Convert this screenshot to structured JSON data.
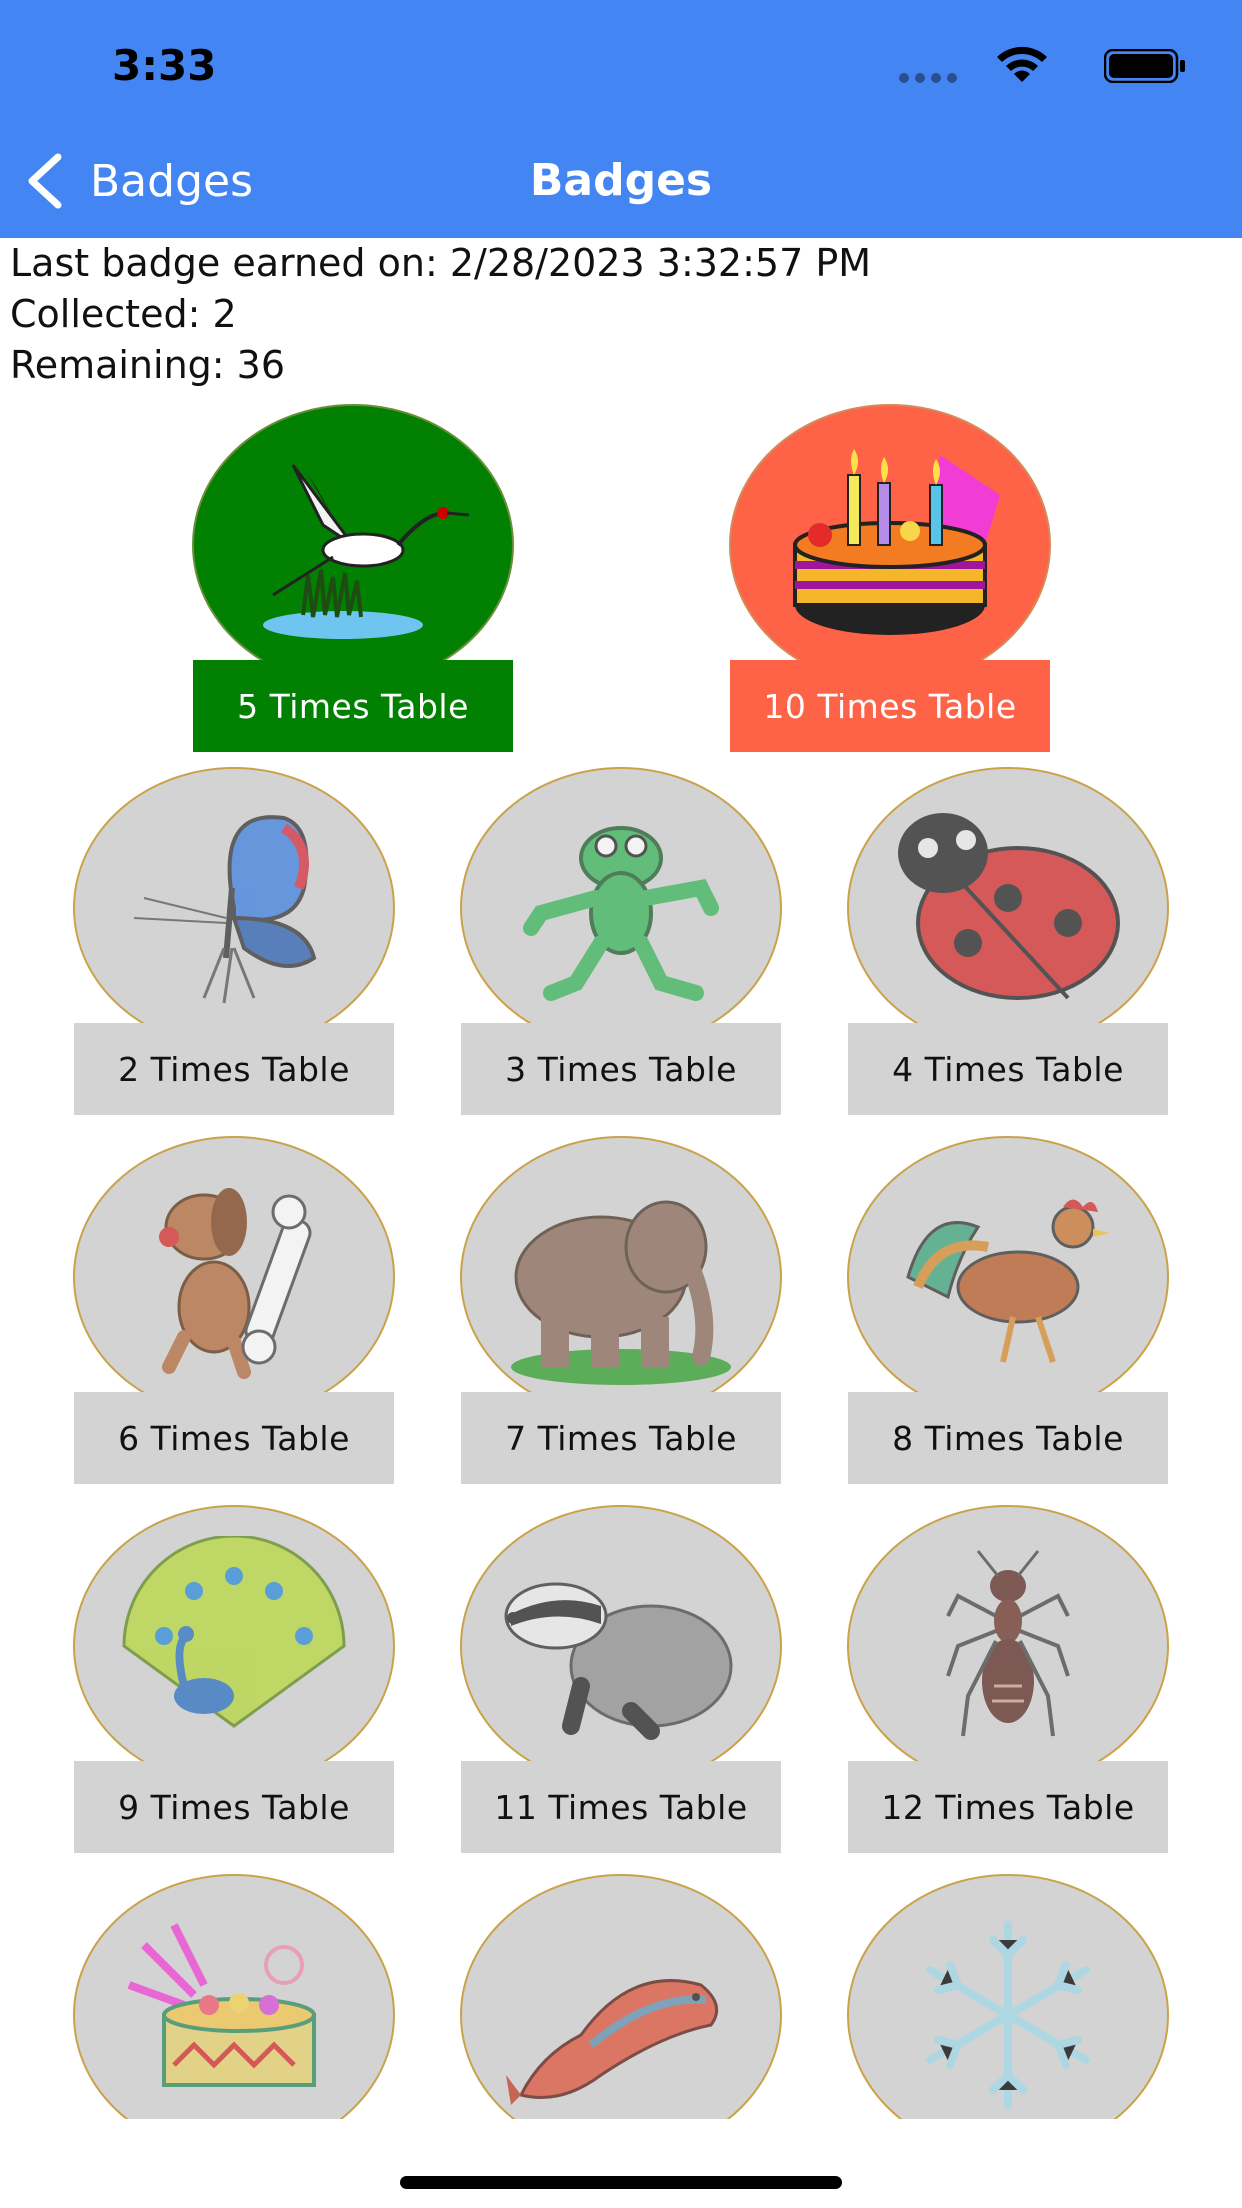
{
  "status_bar": {
    "time": "3:33",
    "icons": [
      "signal-icon",
      "wifi-icon",
      "battery-icon"
    ]
  },
  "nav": {
    "back_label": "Badges",
    "title": "Badges",
    "back_icon": "chevron-left-icon"
  },
  "info": {
    "last_earned": "Last badge earned on: 2/28/2023 3:32:57 PM",
    "collected": "Collected: 2",
    "remaining": "Remaining: 36"
  },
  "badges": [
    {
      "label": "5 Times Table",
      "icon": "crane-icon",
      "state": "earned",
      "color": "#018001"
    },
    {
      "label": "10 Times Table",
      "icon": "birthday-cake-icon",
      "state": "earned",
      "color": "#fe6347"
    },
    {
      "label": "2 Times Table",
      "icon": "butterfly-icon",
      "state": "locked"
    },
    {
      "label": "3 Times Table",
      "icon": "frog-icon",
      "state": "locked"
    },
    {
      "label": "4 Times Table",
      "icon": "ladybug-icon",
      "state": "locked"
    },
    {
      "label": "6 Times Table",
      "icon": "dog-with-bone-icon",
      "state": "locked"
    },
    {
      "label": "7 Times Table",
      "icon": "elephant-icon",
      "state": "locked"
    },
    {
      "label": "8 Times Table",
      "icon": "rooster-icon",
      "state": "locked"
    },
    {
      "label": "9 Times Table",
      "icon": "peacock-icon",
      "state": "locked"
    },
    {
      "label": "11 Times Table",
      "icon": "badger-icon",
      "state": "locked"
    },
    {
      "label": "12 Times Table",
      "icon": "ant-icon",
      "state": "locked"
    },
    {
      "icon": "cake-icon",
      "state": "locked"
    },
    {
      "icon": "salmon-icon",
      "state": "locked"
    },
    {
      "icon": "snowflake-icon",
      "state": "locked"
    }
  ],
  "colors": {
    "nav_bar": "#4385f3",
    "locked_badge": "#d3d3d3",
    "badge_border": "#caa24a"
  }
}
